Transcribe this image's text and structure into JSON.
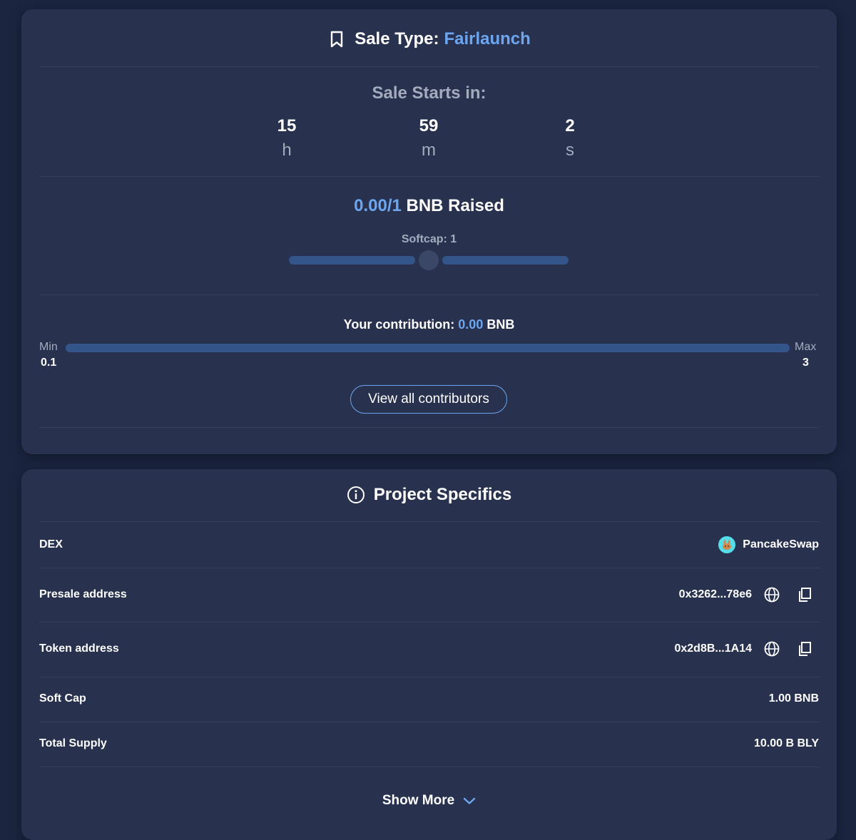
{
  "sale": {
    "title_prefix": "Sale Type: ",
    "sale_type": "Fairlaunch",
    "starts_label": "Sale Starts in:",
    "countdown": [
      {
        "value": "15",
        "unit": "h"
      },
      {
        "value": "59",
        "unit": "m"
      },
      {
        "value": "2",
        "unit": "s"
      }
    ],
    "raised_amount": "0.00/1",
    "raised_suffix": " BNB Raised",
    "raised_progress_percent": 0,
    "softcap_label": "Softcap: 1",
    "contribution_prefix": "Your contribution: ",
    "contribution_value": "0.00",
    "contribution_suffix": " BNB",
    "min_label": "Min",
    "min_value": "0.1",
    "max_label": "Max",
    "max_value": "3",
    "view_contributors_label": "View all contributors"
  },
  "specs": {
    "title": "Project Specifics",
    "rows": [
      {
        "label": "DEX",
        "value": "PancakeSwap"
      },
      {
        "label": "Presale address",
        "value": "0x3262...78e6"
      },
      {
        "label": "Token address",
        "value": "0x2d8B...1A14"
      },
      {
        "label": "Soft Cap",
        "value": "1.00 BNB"
      },
      {
        "label": "Total Supply",
        "value": "10.00 B BLY"
      }
    ],
    "show_more_label": "Show More"
  },
  "colors": {
    "background": "#1b2540",
    "card": "#28324f",
    "accent": "#6da6f0",
    "progress_track": "#33558a",
    "muted_text": "#a3abbd"
  },
  "icons": [
    "bookmark-icon",
    "info-icon",
    "pancakeswap-logo",
    "globe-icon",
    "copy-icon",
    "chevron-down-icon"
  ]
}
